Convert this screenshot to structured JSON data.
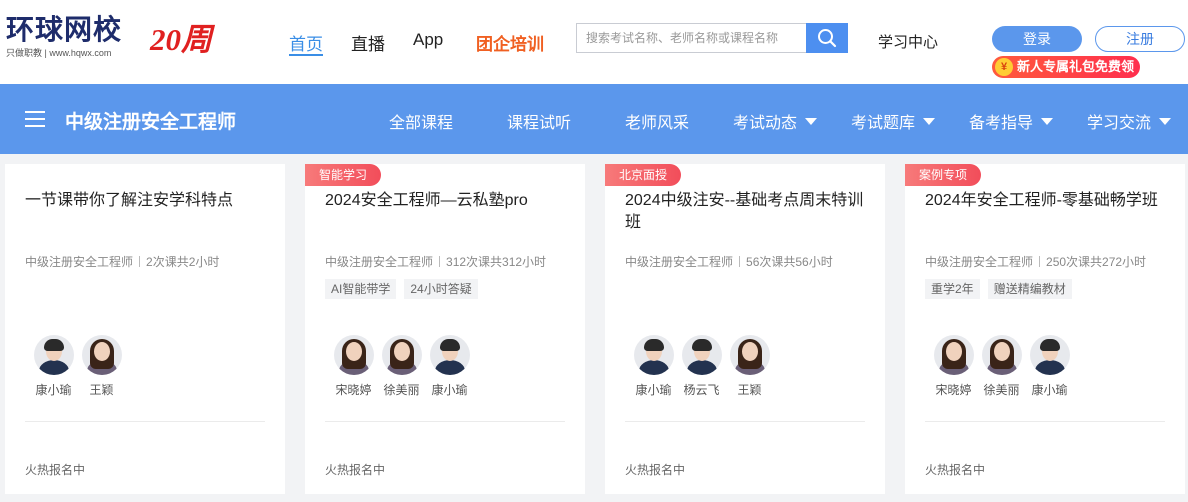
{
  "header": {
    "logo_text": "环球网校",
    "logo_sub": "只做职教 | www.hqwx.com",
    "anniversary": "20周",
    "nav": [
      {
        "label": "首页",
        "active": true
      },
      {
        "label": "直播"
      },
      {
        "label": "App"
      },
      {
        "label": "团企培训",
        "promo": true
      }
    ],
    "search": {
      "placeholder": "搜索考试名称、老师名称或课程名称",
      "value": ""
    },
    "study_center": "学习中心",
    "login": "登录",
    "register": "注册",
    "gift": {
      "coin": "¥",
      "label": "新人专属礼包免费领"
    }
  },
  "subnav": {
    "title": "中级注册安全工程师",
    "items": [
      {
        "label": "全部课程"
      },
      {
        "label": "课程试听"
      },
      {
        "label": "老师风采"
      },
      {
        "label": "考试动态",
        "dropdown": true
      },
      {
        "label": "考试题库",
        "dropdown": true
      },
      {
        "label": "备考指导",
        "dropdown": true
      },
      {
        "label": "学习交流",
        "dropdown": true
      }
    ]
  },
  "cards": [
    {
      "tag": "",
      "title": "一节课带你了解注安学科特点",
      "subject": "中级注册安全工程师",
      "sessions": "2次课共2小时",
      "badges": [],
      "teachers": [
        {
          "name": "康小瑜",
          "gender": "male"
        },
        {
          "name": "王颖",
          "gender": "female"
        }
      ],
      "status": "火热报名中"
    },
    {
      "tag": "智能学习",
      "title": "2024安全工程师—云私塾pro",
      "subject": "中级注册安全工程师",
      "sessions": "312次课共312小时",
      "badges": [
        "AI智能带学",
        "24小时答疑"
      ],
      "teachers": [
        {
          "name": "宋晓婷",
          "gender": "female"
        },
        {
          "name": "徐美丽",
          "gender": "female"
        },
        {
          "name": "康小瑜",
          "gender": "male"
        }
      ],
      "status": "火热报名中"
    },
    {
      "tag": "北京面授",
      "title": "2024中级注安--基础考点周末特训班",
      "subject": "中级注册安全工程师",
      "sessions": "56次课共56小时",
      "badges": [],
      "teachers": [
        {
          "name": "康小瑜",
          "gender": "male"
        },
        {
          "name": "杨云飞",
          "gender": "male"
        },
        {
          "name": "王颖",
          "gender": "female"
        }
      ],
      "status": "火热报名中"
    },
    {
      "tag": "案例专项",
      "title": "2024年安全工程师-零基础畅学班",
      "subject": "中级注册安全工程师",
      "sessions": "250次课共272小时",
      "badges": [
        "重学2年",
        "赠送精编教材"
      ],
      "teachers": [
        {
          "name": "宋晓婷",
          "gender": "female"
        },
        {
          "name": "徐美丽",
          "gender": "female"
        },
        {
          "name": "康小瑜",
          "gender": "male"
        }
      ],
      "status": "火热报名中"
    }
  ],
  "colors": {
    "accent": "#5b97ec",
    "promo": "#f06022",
    "tag": "#f24d5a"
  }
}
